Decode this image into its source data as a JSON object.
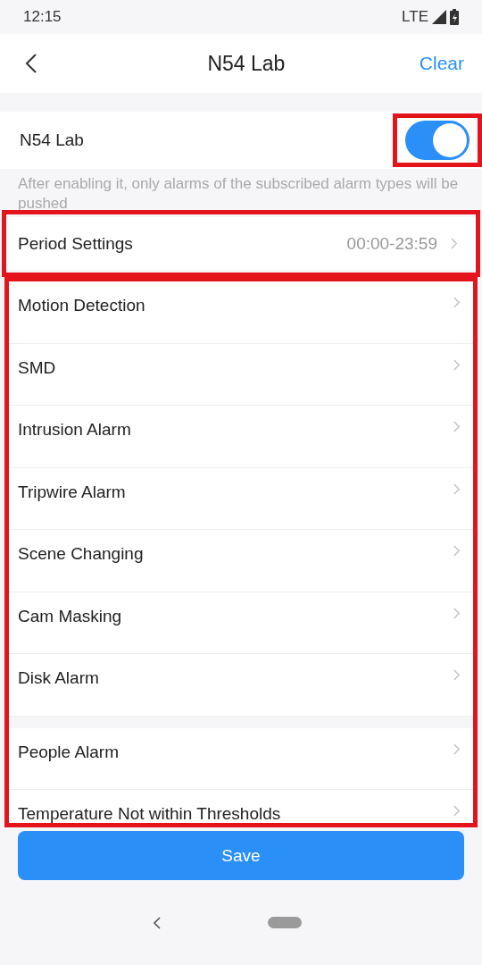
{
  "status_bar": {
    "time": "12:15",
    "network": "LTE"
  },
  "header": {
    "title": "N54 Lab",
    "action": "Clear"
  },
  "subscription": {
    "label": "N54 Lab",
    "on": true,
    "highlighted": true,
    "hint": "After enabling it, only alarms of the subscribed alarm types will be pushed"
  },
  "period": {
    "label": "Period Settings",
    "value": "00:00-23:59",
    "highlighted": true
  },
  "alarm_list": {
    "highlighted": true,
    "groups": [
      {
        "items": [
          "Motion Detection",
          "SMD",
          "Intrusion Alarm",
          "Tripwire Alarm",
          "Scene Changing",
          "Cam Masking",
          "Disk Alarm"
        ]
      },
      {
        "items": [
          "People Alarm",
          "Temperature Not within Thresholds"
        ]
      }
    ]
  },
  "save_button": "Save"
}
